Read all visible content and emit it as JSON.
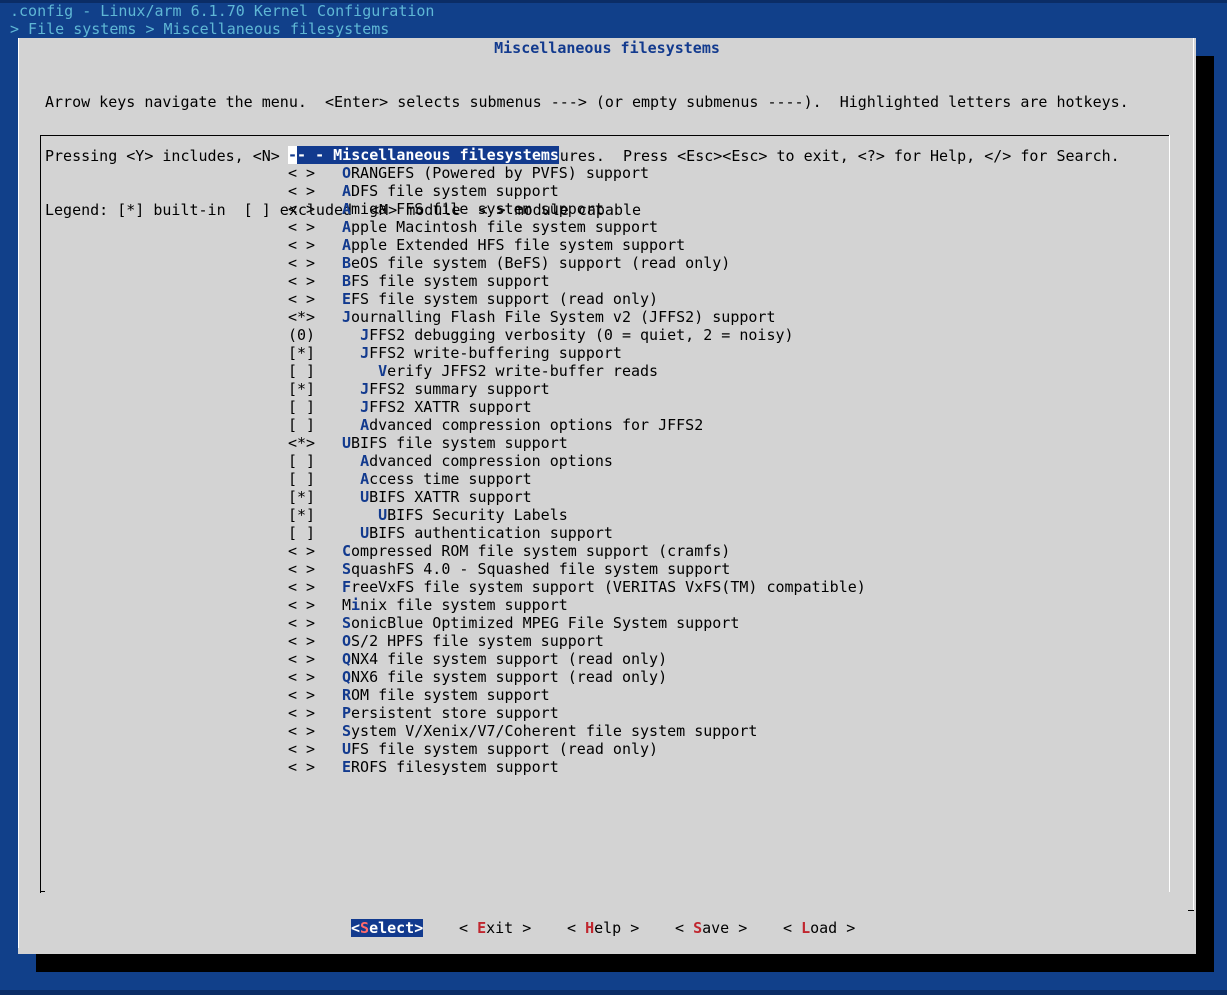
{
  "header": {
    "config_line": ".config - Linux/arm 6.1.70 Kernel Configuration",
    "breadcrumb": "> File systems > Miscellaneous filesystems"
  },
  "dialog": {
    "title": "Miscellaneous filesystems",
    "help_lines": [
      "Arrow keys navigate the menu.  <Enter> selects submenus ---> (or empty submenus ----).  Highlighted letters are hotkeys.",
      "Pressing <Y> includes, <N> excludes, <M> modularizes features.  Press <Esc><Esc> to exit, <?> for Help, </> for Search.",
      "Legend: [*] built-in  [ ] excluded  <M> module  < > module capable"
    ]
  },
  "menu": [
    {
      "mark": "",
      "indent": 0,
      "hotkey": "",
      "text": "- Miscellaneous filesystems",
      "selected": true
    },
    {
      "mark": "< >",
      "indent": 0,
      "hotkey": "O",
      "text": "RANGEFS (Powered by PVFS) support"
    },
    {
      "mark": "< >",
      "indent": 0,
      "hotkey": "A",
      "text": "DFS file system support"
    },
    {
      "mark": "< >",
      "indent": 0,
      "hotkey": "A",
      "text": "miga FFS file system support"
    },
    {
      "mark": "< >",
      "indent": 0,
      "hotkey": "A",
      "text": "pple Macintosh file system support"
    },
    {
      "mark": "< >",
      "indent": 0,
      "hotkey": "A",
      "text": "pple Extended HFS file system support"
    },
    {
      "mark": "< >",
      "indent": 0,
      "hotkey": "B",
      "text": "eOS file system (BeFS) support (read only)"
    },
    {
      "mark": "< >",
      "indent": 0,
      "hotkey": "B",
      "text": "FS file system support"
    },
    {
      "mark": "< >",
      "indent": 0,
      "hotkey": "E",
      "text": "FS file system support (read only)"
    },
    {
      "mark": "<*>",
      "indent": 0,
      "hotkey": "J",
      "text": "ournalling Flash File System v2 (JFFS2) support"
    },
    {
      "mark": "(0)",
      "indent": 1,
      "hotkey": "J",
      "text": "FFS2 debugging verbosity (0 = quiet, 2 = noisy)"
    },
    {
      "mark": "[*]",
      "indent": 1,
      "hotkey": "J",
      "text": "FFS2 write-buffering support"
    },
    {
      "mark": "[ ]",
      "indent": 2,
      "hotkey": "V",
      "text": "erify JFFS2 write-buffer reads"
    },
    {
      "mark": "[*]",
      "indent": 1,
      "hotkey": "J",
      "text": "FFS2 summary support"
    },
    {
      "mark": "[ ]",
      "indent": 1,
      "hotkey": "J",
      "text": "FFS2 XATTR support"
    },
    {
      "mark": "[ ]",
      "indent": 1,
      "hotkey": "A",
      "text": "dvanced compression options for JFFS2"
    },
    {
      "mark": "<*>",
      "indent": 0,
      "hotkey": "U",
      "text": "BIFS file system support"
    },
    {
      "mark": "[ ]",
      "indent": 1,
      "hotkey": "A",
      "text": "dvanced compression options"
    },
    {
      "mark": "[ ]",
      "indent": 1,
      "hotkey": "A",
      "text": "ccess time support"
    },
    {
      "mark": "[*]",
      "indent": 1,
      "hotkey": "U",
      "text": "BIFS XATTR support"
    },
    {
      "mark": "[*]",
      "indent": 2,
      "hotkey": "U",
      "text": "BIFS Security Labels"
    },
    {
      "mark": "[ ]",
      "indent": 1,
      "hotkey": "U",
      "text": "BIFS authentication support"
    },
    {
      "mark": "< >",
      "indent": 0,
      "hotkey": "C",
      "text": "ompressed ROM file system support (cramfs)"
    },
    {
      "mark": "< >",
      "indent": 0,
      "hotkey": "S",
      "text": "quashFS 4.0 - Squashed file system support"
    },
    {
      "mark": "< >",
      "indent": 0,
      "hotkey": "F",
      "text": "reeVxFS file system support (VERITAS VxFS(TM) compatible)"
    },
    {
      "mark": "< >",
      "indent": 0,
      "hotkey": "M",
      "prefix": "M",
      "hotkey_mid": "i",
      "text": "nix file system support"
    },
    {
      "mark": "< >",
      "indent": 0,
      "hotkey": "S",
      "text": "onicBlue Optimized MPEG File System support"
    },
    {
      "mark": "< >",
      "indent": 0,
      "hotkey": "O",
      "text": "S/2 HPFS file system support"
    },
    {
      "mark": "< >",
      "indent": 0,
      "hotkey": "Q",
      "text": "NX4 file system support (read only)"
    },
    {
      "mark": "< >",
      "indent": 0,
      "hotkey": "Q",
      "text": "NX6 file system support (read only)"
    },
    {
      "mark": "< >",
      "indent": 0,
      "hotkey": "R",
      "text": "OM file system support"
    },
    {
      "mark": "< >",
      "indent": 0,
      "hotkey": "P",
      "text": "ersistent store support"
    },
    {
      "mark": "< >",
      "indent": 0,
      "hotkey": "S",
      "text": "ystem V/Xenix/V7/Coherent file system support"
    },
    {
      "mark": "< >",
      "indent": 0,
      "hotkey": "U",
      "text": "FS file system support (read only)"
    },
    {
      "mark": "< >",
      "indent": 0,
      "hotkey": "E",
      "text": "ROFS filesystem support"
    }
  ],
  "buttons": [
    {
      "id": "select",
      "pre": "<",
      "hotkey": "S",
      "post": "elect>",
      "active": true
    },
    {
      "id": "exit",
      "pre": "< ",
      "hotkey": "E",
      "post": "xit >",
      "active": false
    },
    {
      "id": "help",
      "pre": "< ",
      "hotkey": "H",
      "post": "elp >",
      "active": false
    },
    {
      "id": "save",
      "pre": "< ",
      "hotkey": "S",
      "post": "ave >",
      "active": false
    },
    {
      "id": "load",
      "pre": "< ",
      "hotkey": "L",
      "post": "oad >",
      "active": false
    }
  ],
  "colors": {
    "background": "#11408a",
    "dialog": "#d3d3d3",
    "highlight": "#123a8e",
    "hotkey_button": "#c0262e",
    "header_text": "#5fb7d5"
  }
}
